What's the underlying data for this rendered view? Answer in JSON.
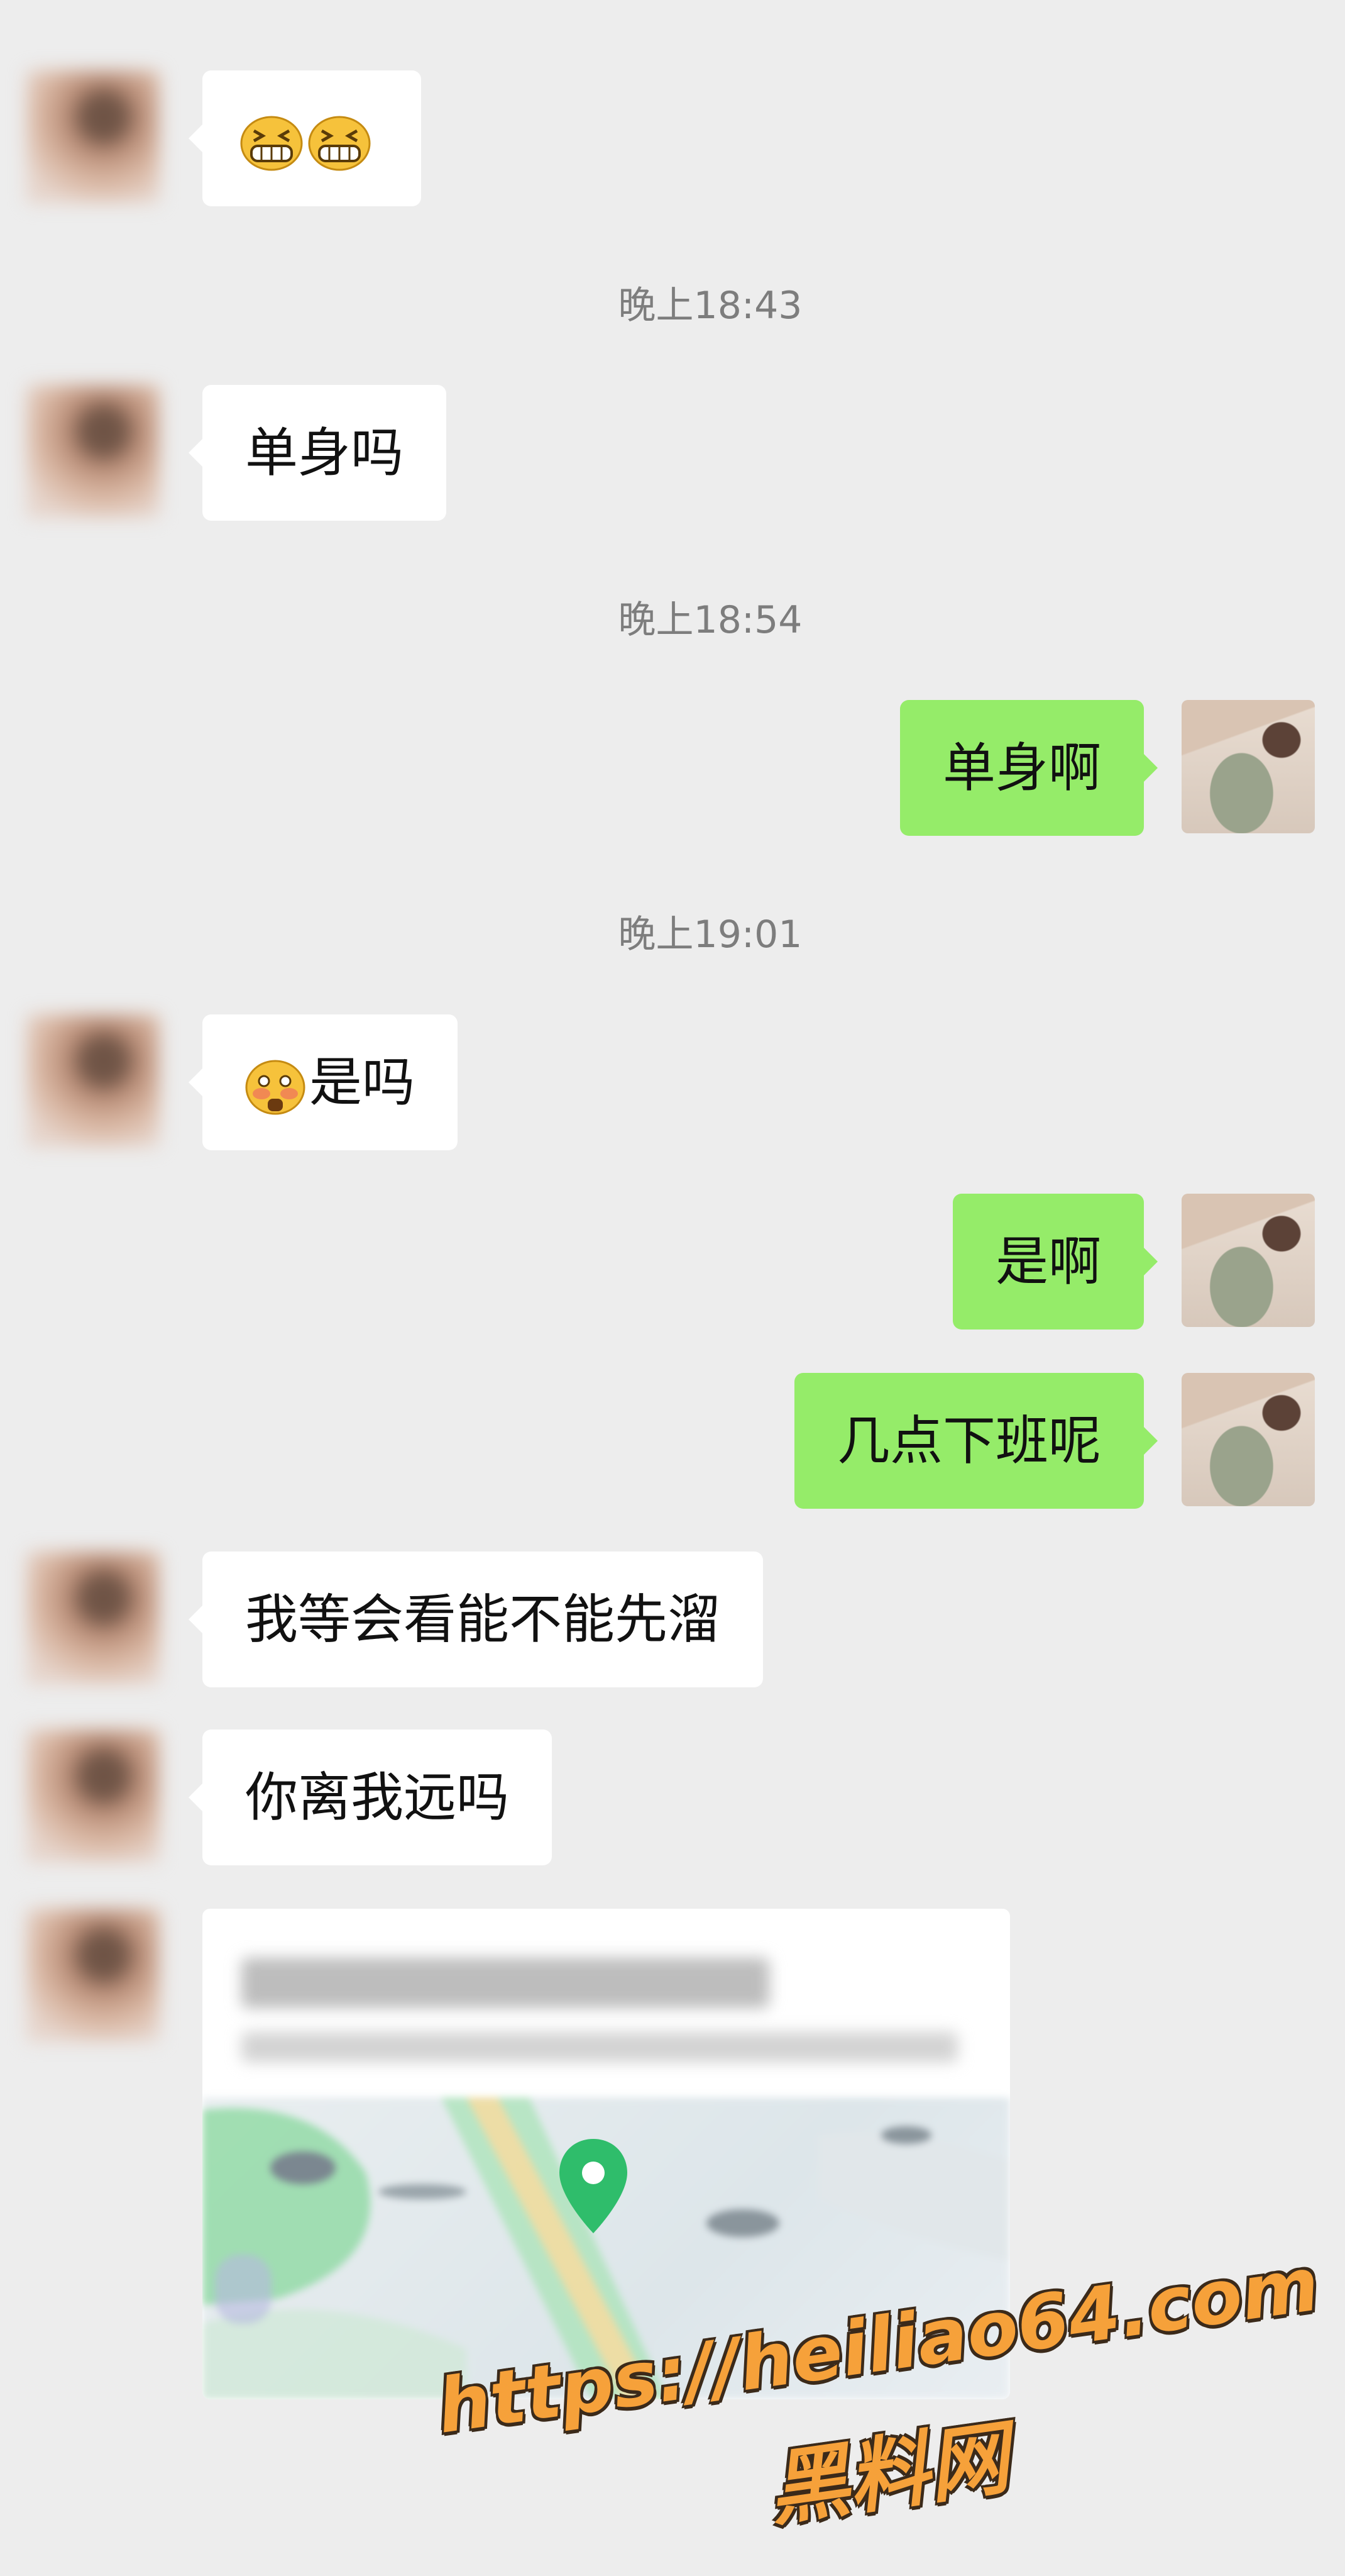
{
  "messages": {
    "m1": {
      "emoji": [
        "grin-emoji",
        "grin-emoji"
      ]
    },
    "t1": "晚上18:43",
    "m2": "单身吗",
    "t2": "晚上18:54",
    "m3": "单身啊",
    "t3": "晚上19:01",
    "m4": {
      "emoji": "flushed-emoji",
      "text": "是吗"
    },
    "m5": "是啊",
    "m6": "几点下班呢",
    "m7": "我等会看能不能先溜",
    "m8": "你离我远吗"
  },
  "watermark": {
    "url": "https://heiliao64.com",
    "site": "黑料网"
  },
  "colors": {
    "background": "#ededed",
    "incoming": "#ffffff",
    "outgoing": "#95ec69",
    "map_pin": "#2fbd6b",
    "watermark": "#f6a13a"
  }
}
